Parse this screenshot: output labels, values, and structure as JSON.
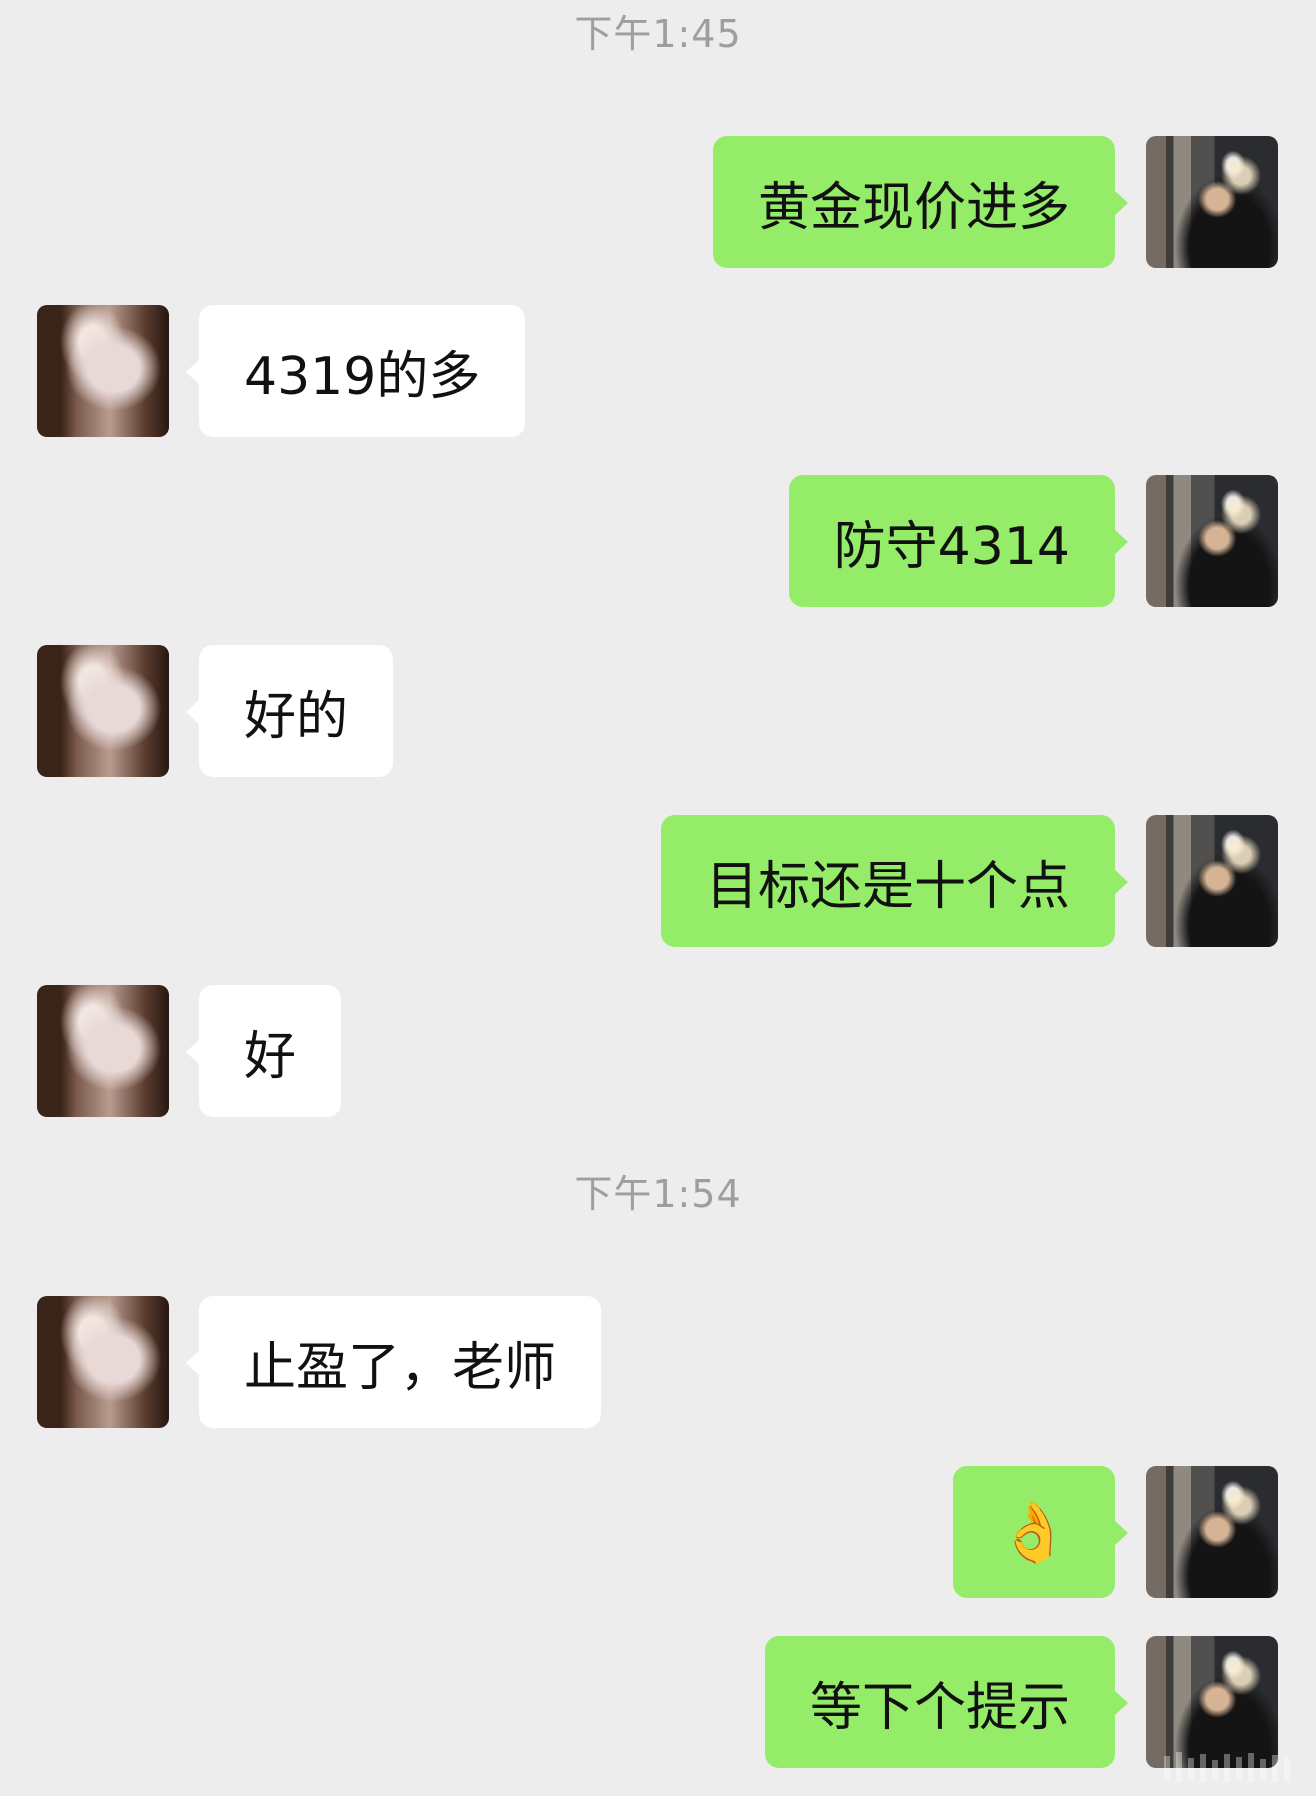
{
  "timestamps": [
    "下午1:45",
    "下午1:54"
  ],
  "messages": [
    {
      "sender": "me",
      "text": "黄金现价进多"
    },
    {
      "sender": "them",
      "text": "4319的多"
    },
    {
      "sender": "me",
      "text": "防守4314"
    },
    {
      "sender": "them",
      "text": "好的"
    },
    {
      "sender": "me",
      "text": "目标还是十个点"
    },
    {
      "sender": "them",
      "text": "好"
    },
    {
      "sender": "them",
      "text": "止盈了，老师"
    },
    {
      "sender": "me",
      "text": "👌"
    },
    {
      "sender": "me",
      "text": "等下个提示"
    }
  ],
  "colors": {
    "background": "#ededed",
    "sent_bubble": "#95ec69",
    "received_bubble": "#ffffff",
    "timestamp_text": "#9e9e9e"
  },
  "icons": {
    "ok_emoji": "ok-hand-emoji-icon"
  }
}
